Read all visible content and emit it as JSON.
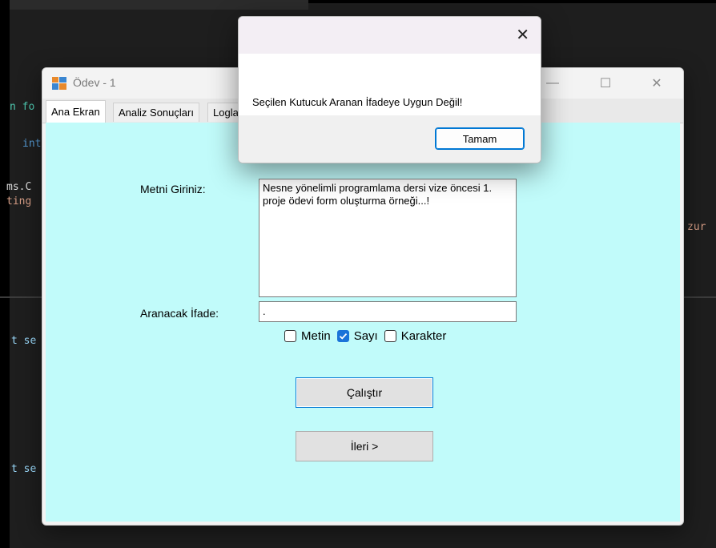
{
  "editor": {
    "fragments": [
      "n fo",
      "int",
      "ms.C",
      "ting",
      "t se",
      "t se",
      "zur"
    ]
  },
  "window": {
    "title": "Ödev - 1",
    "min_glyph": "—",
    "max_glyph": "☐",
    "close_glyph": "✕",
    "tabs": [
      {
        "label": "Ana Ekran"
      },
      {
        "label": "Analiz Sonuçları"
      },
      {
        "label": "Logla"
      }
    ]
  },
  "form": {
    "text_label": "Metni Giriniz:",
    "text_value": "Nesne yönelimli programlama dersi vize öncesi 1. proje ödevi form oluşturma örneği...!",
    "search_label": "Aranacak İfade:",
    "search_value": ".",
    "checkboxes": [
      {
        "label": "Metin",
        "checked": false
      },
      {
        "label": "Sayı",
        "checked": true
      },
      {
        "label": "Karakter",
        "checked": false
      }
    ],
    "run_button": "Çalıştır",
    "next_button": "İleri >"
  },
  "dialog": {
    "message": "Seçilen Kutucuk Aranan İfadeye Uygun Değil!",
    "ok_button": "Tamam",
    "close_glyph": "✕"
  },
  "colors": {
    "content_bg": "#c1fbfa",
    "accent": "#0078d4",
    "checkbox_checked": "#1a73d9"
  }
}
